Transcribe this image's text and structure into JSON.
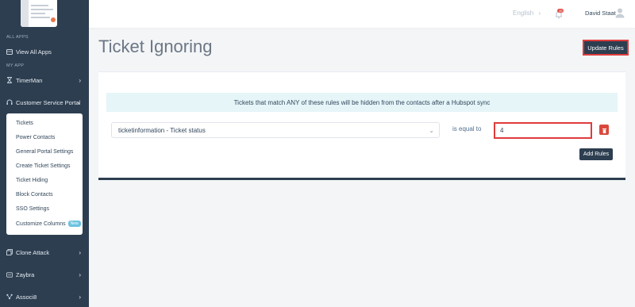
{
  "sidebar": {
    "all_apps_label": "ALL APPS",
    "view_all_apps": "View All Apps",
    "my_app_label": "MY APP",
    "timerman": "TimerMan",
    "customer_service_portal": "Customer Service Portal",
    "submenu": [
      {
        "label": "Tickets"
      },
      {
        "label": "Power Contacts"
      },
      {
        "label": "General Portal Settings"
      },
      {
        "label": "Create Ticket Settings"
      },
      {
        "label": "Ticket Hiding"
      },
      {
        "label": "Block Contacts"
      },
      {
        "label": "SSO Settings"
      },
      {
        "label": "Customize Columns",
        "badge": "New"
      }
    ],
    "clone_attack": "Clone Attack",
    "zaybra": "Zaybra",
    "associ8": "Associ8"
  },
  "topbar": {
    "language": "English",
    "notification_count": "10",
    "user_name": "David Staat"
  },
  "main": {
    "title": "Ticket Ignoring",
    "update_button": "Update Rules",
    "info_banner": "Tickets that match ANY of these rules will be hidden from the contacts after a Hubspot sync",
    "rule": {
      "field_value": "ticketinformation - Ticket status",
      "operator": "is equal to",
      "value": "4"
    },
    "add_button": "Add Rules"
  },
  "colors": {
    "sidebar_bg": "#2d3e50",
    "highlight_red": "#e03b3b",
    "banner_bg": "#e5f5f8",
    "delete_red": "#d9483b"
  }
}
